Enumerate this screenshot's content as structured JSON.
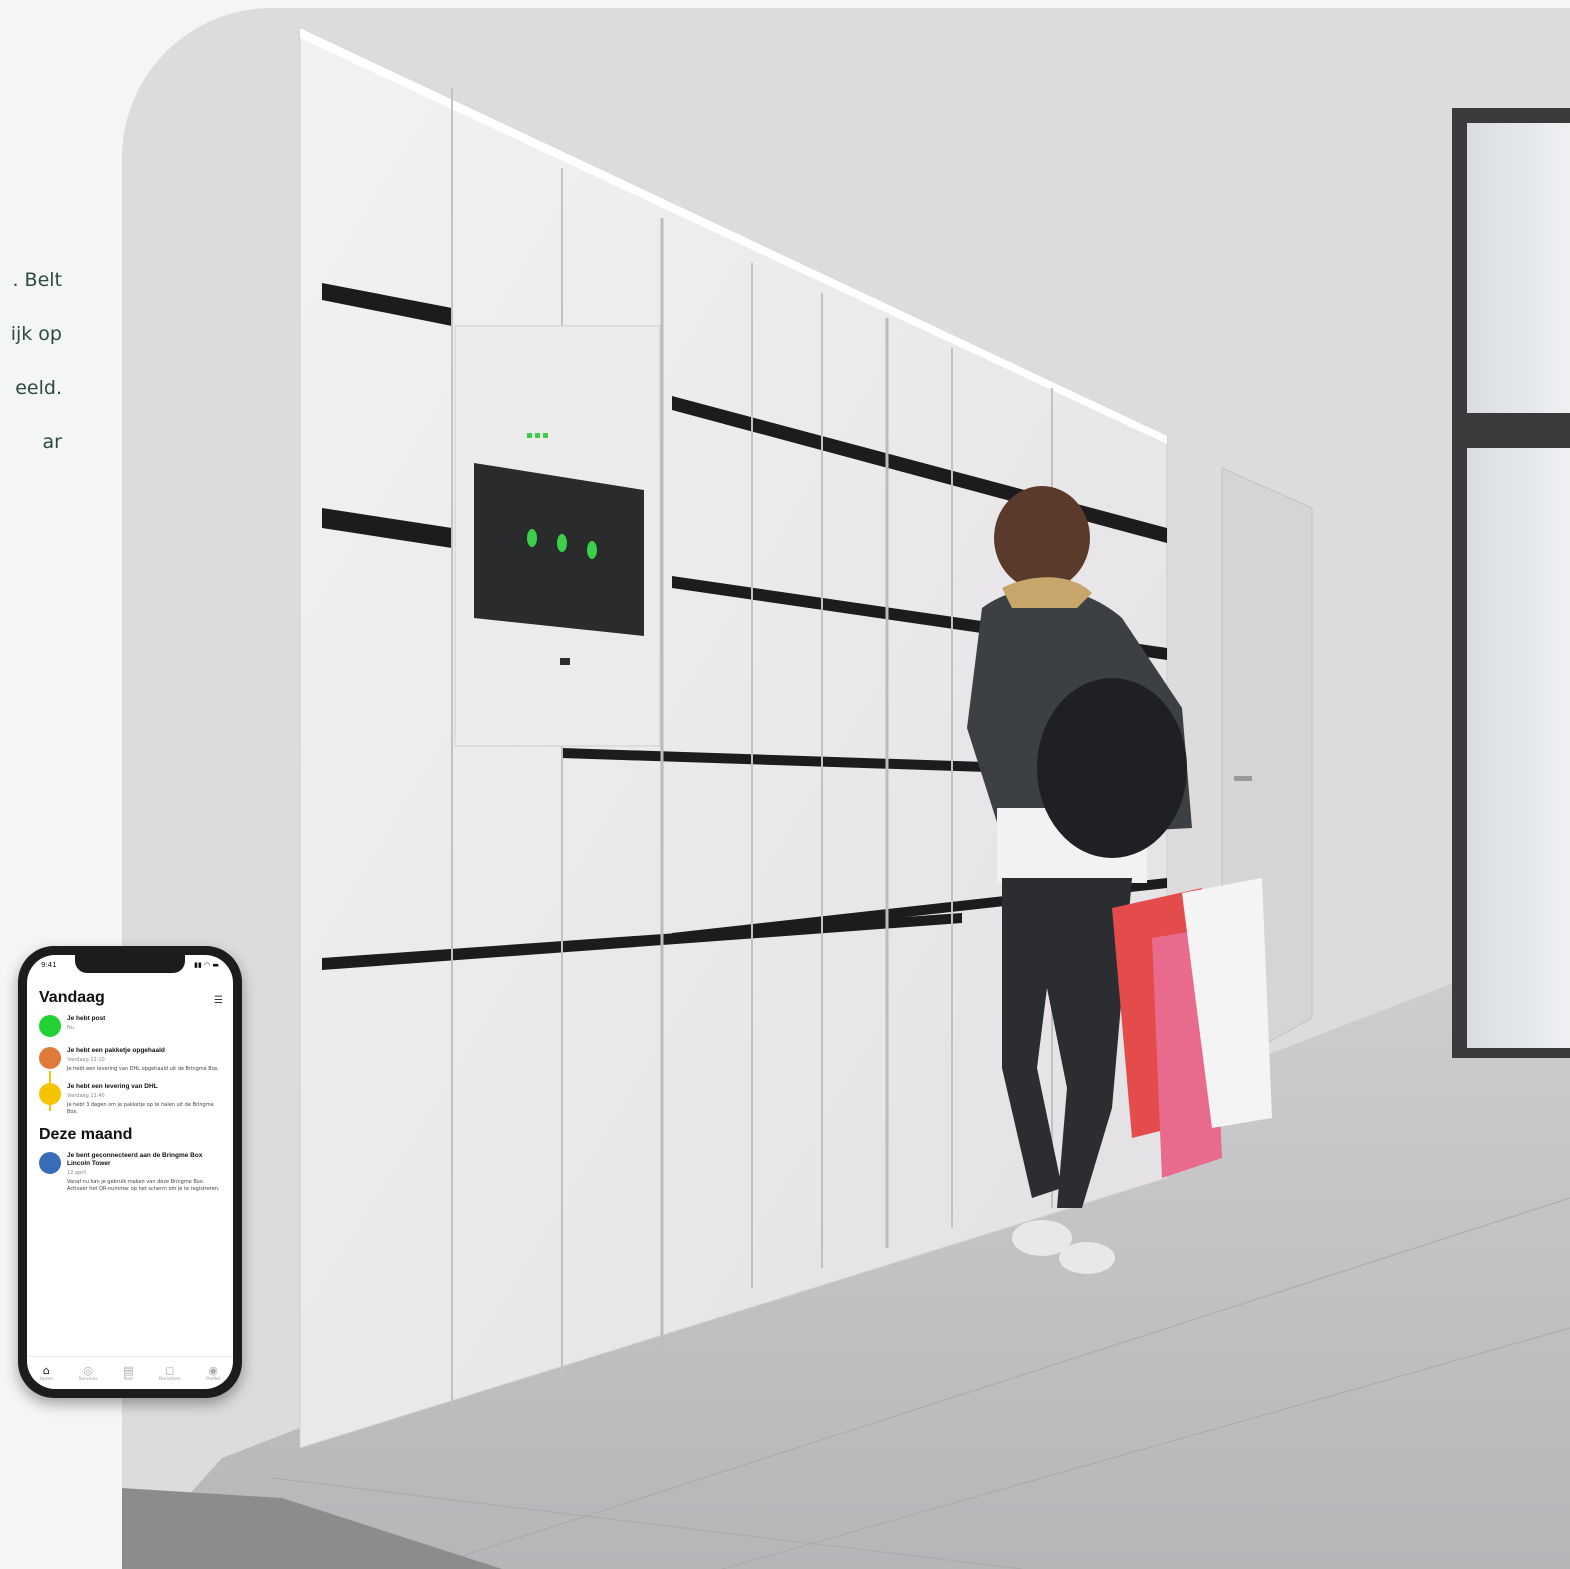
{
  "intro_lines": [
    ". Belt",
    "ijk op",
    "eeld.",
    "ar"
  ],
  "phone": {
    "status_time": "9:41",
    "status_icons": "▮▮ ◠ ▬",
    "today_heading": "Vandaag",
    "month_heading": "Deze maand",
    "today_items": [
      {
        "title": "Je hebt post",
        "sub": "Nu",
        "desc": "",
        "color": "#22d133"
      },
      {
        "title": "Je hebt een pakketje opgehaald",
        "sub": "Vandaag 12:10",
        "desc": "Je hebt een levering van DHL opgehaald uit de Bringme Box.",
        "color": "#e07a3a"
      },
      {
        "title": "Je hebt een levering van DHL",
        "sub": "Vandaag 11:40",
        "desc": "Je hebt 3 dagen om je pakketje op te halen uit de Bringme Box.",
        "color": "#f5c400"
      }
    ],
    "month_items": [
      {
        "title": "Je bent geconnecteerd aan de Bringme Box Lincoln Tower",
        "sub": "12 april",
        "desc": "Vanaf nu kan je gebruik maken van deze Bringme Box. Activeer het QR-nummer op het scherm om je te registreren.",
        "color": "#3a6db8"
      }
    ],
    "tabs": [
      {
        "label": "Home",
        "icon": "home-icon",
        "glyph": "⌂"
      },
      {
        "label": "Services",
        "icon": "services-icon",
        "glyph": "◎"
      },
      {
        "label": "Post",
        "icon": "post-icon",
        "glyph": "▤"
      },
      {
        "label": "Berichten",
        "icon": "messages-icon",
        "glyph": "◻"
      },
      {
        "label": "Profiel",
        "icon": "profile-icon",
        "glyph": "◉"
      }
    ]
  }
}
